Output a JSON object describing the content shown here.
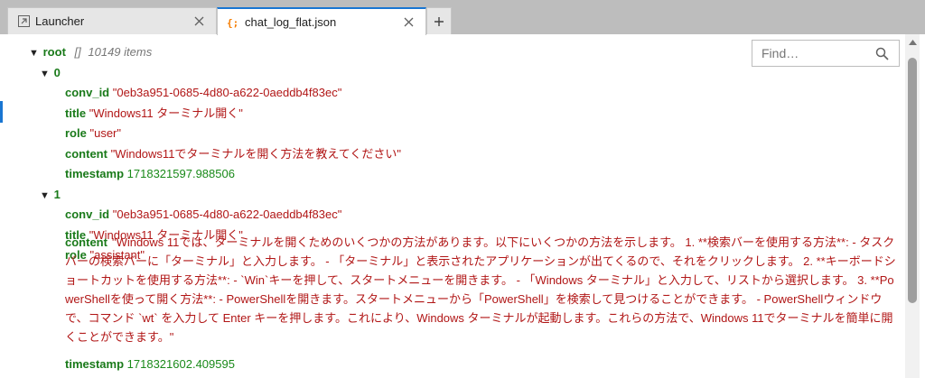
{
  "tabs": [
    {
      "label": "Launcher",
      "icon": "launcher-icon"
    },
    {
      "label": "chat_log_flat.json",
      "icon": "json-file-icon"
    }
  ],
  "find": {
    "placeholder": "Find…",
    "value": ""
  },
  "tree": {
    "root_key": "root",
    "root_bracket": "[]",
    "root_count": "10149 items",
    "items": [
      {
        "index": "0",
        "conv_id_key": "conv_id",
        "conv_id": "\"0eb3a951-0685-4d80-a622-0aeddb4f83ec\"",
        "title_key": "title",
        "title": "\"Windows11 ターミナル開く\"",
        "role_key": "role",
        "role": "\"user\"",
        "content_key": "content",
        "content": "\"Windows11でターミナルを開く方法を教えてください\"",
        "timestamp_key": "timestamp",
        "timestamp": "1718321597.988506"
      },
      {
        "index": "1",
        "conv_id_key": "conv_id",
        "conv_id": "\"0eb3a951-0685-4d80-a622-0aeddb4f83ec\"",
        "title_key": "title",
        "title": "\"Windows11 ターミナル開く\"",
        "role_key": "role",
        "role": "\"assistant\"",
        "content_key": "content",
        "content": "\"Windows 11では、ターミナルを開くためのいくつかの方法があります。以下にいくつかの方法を示します。 1. **検索バーを使用する方法**: - タスクバーの検索バーに「ターミナル」と入力します。 - 「ターミナル」と表示されたアプリケーションが出てくるので、それをクリックします。 2. **キーボードショートカットを使用する方法**: - `Win`キーを押して、スタートメニューを開きます。 - 「Windows ターミナル」と入力して、リストから選択します。 3. **PowerShellを使って開く方法**: - PowerShellを開きます。スタートメニューから「PowerShell」を検索して見つけることができます。 - PowerShellウィンドウで、コマンド `wt` を入力して Enter キーを押します。これにより、Windows ターミナルが起動します。これらの方法で、Windows 11でターミナルを簡単に開くことができます。\"",
        "timestamp_key": "timestamp",
        "timestamp": "1718321602.409595"
      }
    ]
  }
}
